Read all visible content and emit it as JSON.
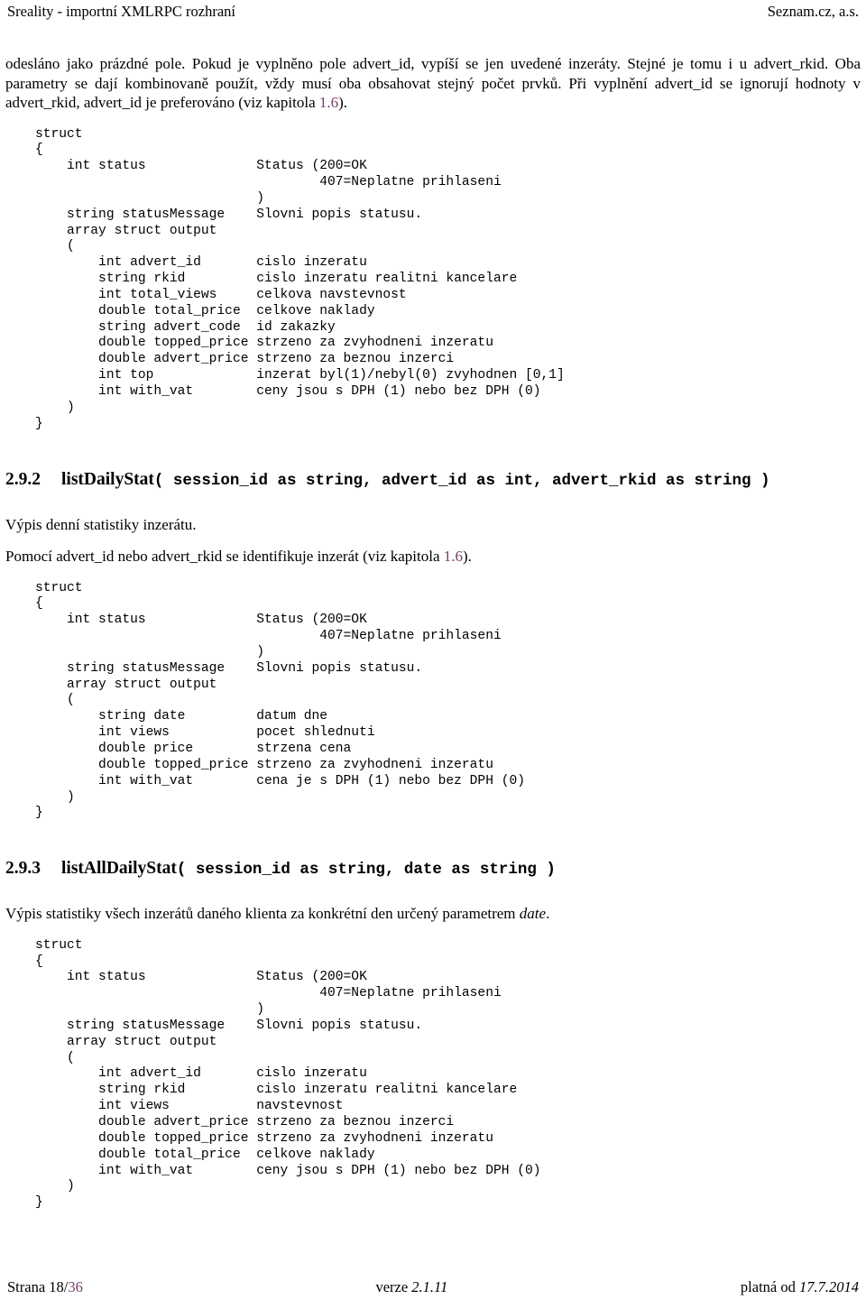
{
  "header": {
    "left": "Sreality - importní XMLRPC rozhraní",
    "right": "Seznam.cz, a.s."
  },
  "intro_paragraph": {
    "part1": "odesláno jako prázdné pole. Pokud je vyplněno pole advert_id, vypíší se jen uvedené inzeráty. Stejné je tomu i u advert_rkid. Oba parametry se dají kombinovaně použít, vždy musí oba obsahovat stejný počet prvků.  Při vyplnění advert_id se ignorují hodnoty v advert_rkid, advert_id je preferováno (viz kapitola ",
    "xref": "1.6",
    "part2": ")."
  },
  "code_block_1": "struct\n{\n    int status              Status (200=OK\n                                    407=Neplatne prihlaseni\n                            )\n    string statusMessage    Slovni popis statusu.\n    array struct output\n    (\n        int advert_id       cislo inzeratu\n        string rkid         cislo inzeratu realitni kancelare\n        int total_views     celkova navstevnost\n        double total_price  celkove naklady\n        string advert_code  id zakazky\n        double topped_price strzeno za zvyhodneni inzeratu\n        double advert_price strzeno za beznou inzerci\n        int top             inzerat byl(1)/nebyl(0) zvyhodnen [0,1]\n        int with_vat        ceny jsou s DPH (1) nebo bez DPH (0)\n    )\n}",
  "section_292": {
    "number": "2.9.2",
    "function_name": "listDailyStat",
    "signature": "( session_id as string, advert_id as int, advert_rkid as string )",
    "paragraph_1": "Výpis denní statistiky inzerátu.",
    "paragraph_2_part1": "Pomocí advert_id nebo advert_rkid se identifikuje inzerát (viz kapitola ",
    "paragraph_2_xref": "1.6",
    "paragraph_2_part2": ").",
    "code_block": "struct\n{\n    int status              Status (200=OK\n                                    407=Neplatne prihlaseni\n                            )\n    string statusMessage    Slovni popis statusu.\n    array struct output\n    (\n        string date         datum dne\n        int views           pocet shlednuti\n        double price        strzena cena\n        double topped_price strzeno za zvyhodneni inzeratu\n        int with_vat        cena je s DPH (1) nebo bez DPH (0)\n    )\n}"
  },
  "section_293": {
    "number": "2.9.3",
    "function_name": "listAllDailyStat",
    "signature": "( session_id as string, date as string )",
    "paragraph_1_part1": "Výpis statistiky všech inzerátů daného klienta za konkrétní den určený parametrem ",
    "paragraph_1_italic": "date",
    "paragraph_1_part2": ".",
    "code_block": "struct\n{\n    int status              Status (200=OK\n                                    407=Neplatne prihlaseni\n                            )\n    string statusMessage    Slovni popis statusu.\n    array struct output\n    (\n        int advert_id       cislo inzeratu\n        string rkid         cislo inzeratu realitni kancelare\n        int views           navstevnost\n        double advert_price strzeno za beznou inzerci\n        double topped_price strzeno za zvyhodneni inzeratu\n        double total_price  celkove naklady\n        int with_vat        ceny jsou s DPH (1) nebo bez DPH (0)\n    )\n}"
  },
  "footer": {
    "page_label": "Strana 18/",
    "page_total": "36",
    "version_label": "verze ",
    "version_value": "2.1.11",
    "valid_label": "platná od ",
    "valid_value": "17.7.2014"
  },
  "colors": {
    "link": "#7a3f6d",
    "text": "#000000",
    "background": "#ffffff"
  }
}
